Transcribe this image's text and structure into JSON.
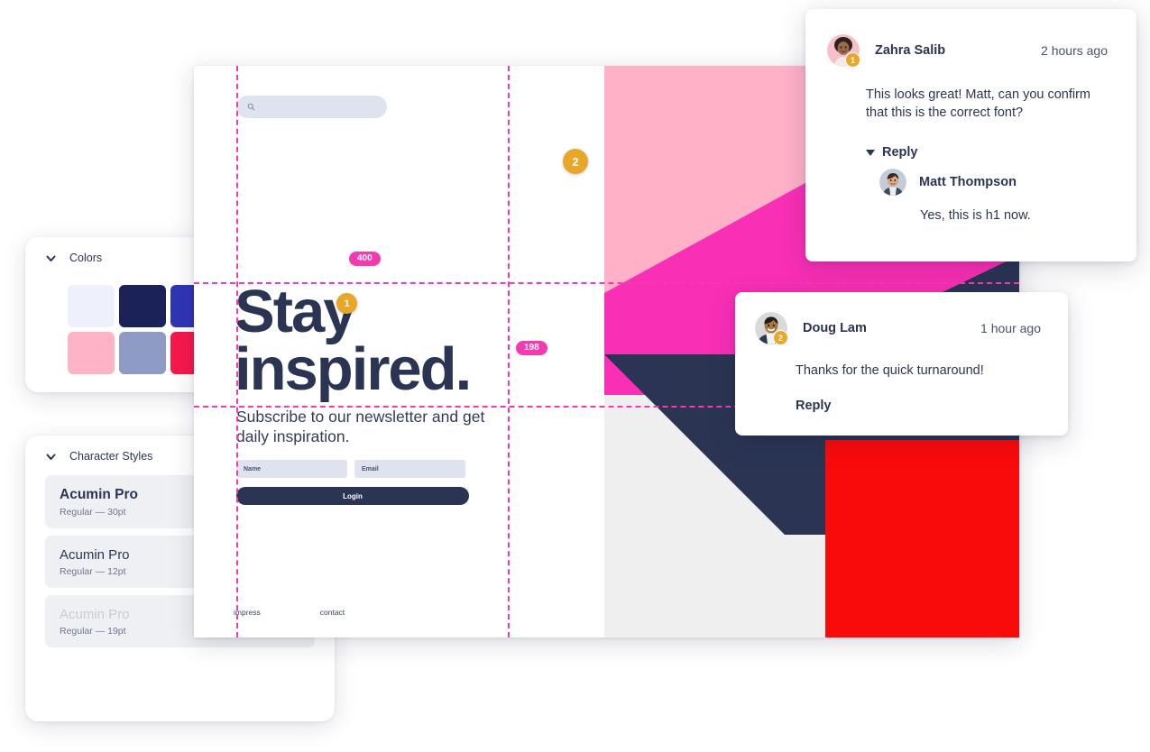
{
  "canvas": {
    "search": {
      "icon": "search-icon",
      "value": "",
      "placeholder": ""
    },
    "headline_line1": "Stay",
    "headline_line2": "inspired.",
    "subhead": "Subscribe to our newsletter and get daily inspiration.",
    "form": {
      "name_label": "Name",
      "email_label": "Email",
      "login_label": "Login"
    },
    "footer": {
      "link1": "impress",
      "link2": "contact"
    },
    "guides": {
      "measure_width": "400",
      "measure_height": "198"
    },
    "pins": {
      "pin1": "1",
      "pin2": "2"
    },
    "artwork_colors": {
      "pink_light": "#ffb1c8",
      "pink_hot": "#f92fb5",
      "navy": "#2b3553",
      "red": "#f90b0b",
      "grey": "#efefef"
    },
    "guide_color": "#f53ab0",
    "pin_color": "#e8a62a"
  },
  "panels": {
    "colors": {
      "title": "Colors",
      "chevron": "chevron-down-icon",
      "swatches": [
        "#eef1fb",
        "#1b2257",
        "#3036b5",
        "#2f56e8",
        "#ffb3c6",
        "#8e9bc4",
        "#f8184b",
        "#25ba86"
      ]
    },
    "character_styles": {
      "title": "Character Styles",
      "chevron": "chevron-down-icon",
      "items": [
        {
          "name": "Acumin Pro",
          "meta": "Regular — 30pt",
          "emphasis": "bold"
        },
        {
          "name": "Acumin Pro",
          "meta": "Regular — 12pt",
          "emphasis": "normal"
        },
        {
          "name": "Acumin Pro",
          "meta": "Regular — 19pt",
          "emphasis": "faded"
        }
      ]
    }
  },
  "comments": [
    {
      "pin": "1",
      "author": "Zahra Salib",
      "time": "2 hours ago",
      "body": "This looks great! Matt, can you confirm that this is the correct font?",
      "reply_toggle": "Reply",
      "reply": {
        "author": "Matt Thompson",
        "body": "Yes, this is h1 now."
      }
    },
    {
      "pin": "2",
      "author": "Doug Lam",
      "time": "1 hour ago",
      "body": "Thanks for the quick turnaround!",
      "reply_toggle": "Reply"
    }
  ]
}
